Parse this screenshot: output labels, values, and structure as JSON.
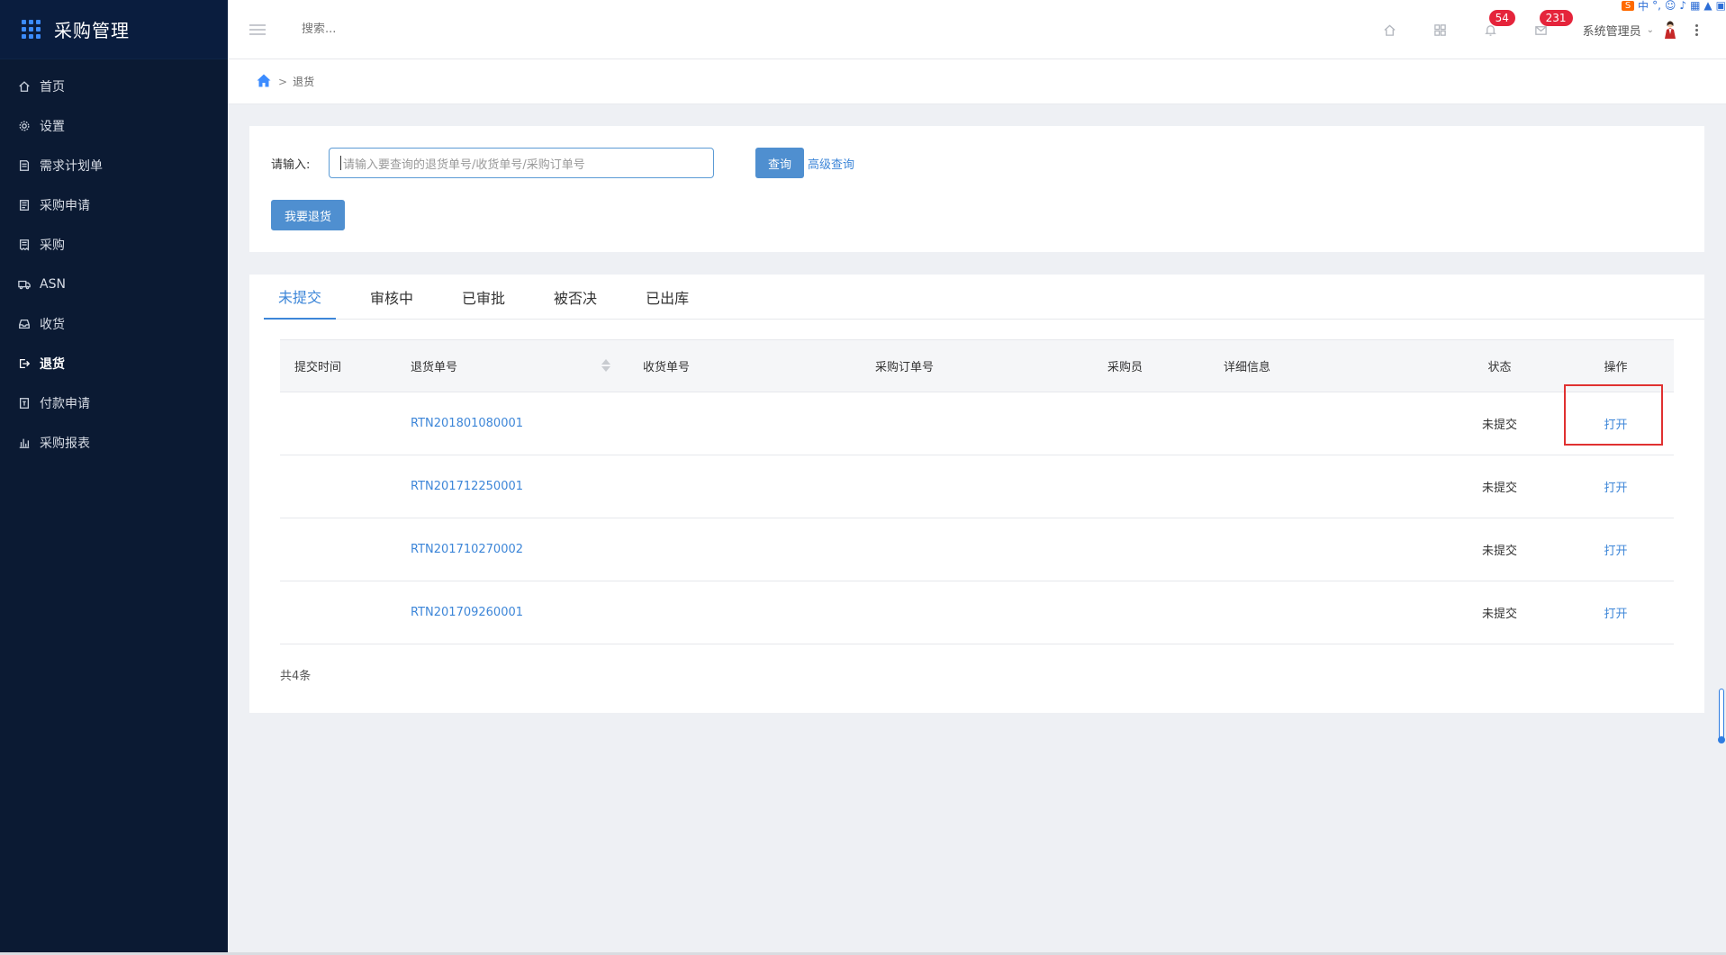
{
  "sidebar": {
    "app_title": "采购管理",
    "items": [
      {
        "label": "首页",
        "icon": "home-icon"
      },
      {
        "label": "设置",
        "icon": "gear-icon"
      },
      {
        "label": "需求计划单",
        "icon": "document-icon"
      },
      {
        "label": "采购申请",
        "icon": "clipboard-icon"
      },
      {
        "label": "采购",
        "icon": "receipt-icon"
      },
      {
        "label": "ASN",
        "icon": "truck-icon"
      },
      {
        "label": "收货",
        "icon": "inbox-icon"
      },
      {
        "label": "退货",
        "icon": "return-icon",
        "active": true
      },
      {
        "label": "付款申请",
        "icon": "payment-icon"
      },
      {
        "label": "采购报表",
        "icon": "bar-chart-icon"
      }
    ]
  },
  "topbar": {
    "search_placeholder": "搜索...",
    "notifications_count": "54",
    "messages_count": "231",
    "user_name": "系统管理员"
  },
  "breadcrumb": {
    "separator": ">",
    "current": "退货"
  },
  "search_panel": {
    "label": "请输入:",
    "input_placeholder": "请输入要查询的退货单号/收货单号/采购订单号",
    "query_button": "查询",
    "advanced_link": "高级查询",
    "return_button": "我要退货"
  },
  "tabs": [
    "未提交",
    "审核中",
    "已审批",
    "被否决",
    "已出库"
  ],
  "table": {
    "headers": [
      "提交时间",
      "退货单号",
      "收货单号",
      "采购订单号",
      "采购员",
      "详细信息",
      "状态",
      "操作"
    ],
    "rows": [
      {
        "submit_time": "",
        "return_no": "RTN201801080001",
        "receipt_no": "",
        "po_no": "",
        "buyer": "",
        "detail": "",
        "status": "未提交",
        "action": "打开"
      },
      {
        "submit_time": "",
        "return_no": "RTN201712250001",
        "receipt_no": "",
        "po_no": "",
        "buyer": "",
        "detail": "",
        "status": "未提交",
        "action": "打开"
      },
      {
        "submit_time": "",
        "return_no": "RTN201710270002",
        "receipt_no": "",
        "po_no": "",
        "buyer": "",
        "detail": "",
        "status": "未提交",
        "action": "打开"
      },
      {
        "submit_time": "",
        "return_no": "RTN201709260001",
        "receipt_no": "",
        "po_no": "",
        "buyer": "",
        "detail": "",
        "status": "未提交",
        "action": "打开"
      }
    ],
    "total": "共4条"
  },
  "ime_tray": {
    "lang": "中"
  },
  "colors": {
    "sidebar_bg": "#0b1a33",
    "accent": "#3d86d8",
    "button_bg": "#4f8fd0",
    "badge": "#e5243b",
    "highlight": "#e03131"
  }
}
